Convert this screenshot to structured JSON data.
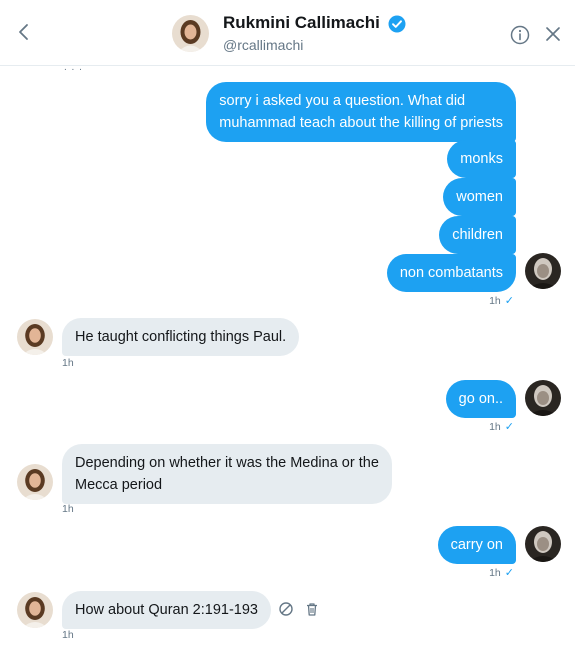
{
  "header": {
    "name": "Rukmini Callimachi",
    "handle": "@rcallimachi"
  },
  "colors": {
    "accent": "#1da1f2",
    "incoming_bubble": "#e6ecf0",
    "muted_text": "#657786"
  },
  "messages": {
    "m1": {
      "lines": [
        "sorry i asked you a question. What did",
        "muhammad teach about the killing of priests"
      ]
    },
    "m2": {
      "text": "monks"
    },
    "m3": {
      "text": "women"
    },
    "m4": {
      "text": "children"
    },
    "m5": {
      "text": "non combatants",
      "time": "1h"
    },
    "m6": {
      "text": "He taught conflicting things Paul.",
      "time": "1h"
    },
    "m7": {
      "text": "go on..",
      "time": "1h"
    },
    "m8": {
      "lines": [
        "Depending on whether it was the Medina or the",
        "Mecca period"
      ],
      "time": "1h"
    },
    "m9": {
      "text": "carry on",
      "time": "1h"
    },
    "m10": {
      "text": "How about Quran 2:191-193",
      "time": "1h"
    }
  },
  "icons": {
    "back": "chevron-left-icon",
    "verified": "verified-badge-icon",
    "info": "info-icon",
    "close": "close-icon",
    "report": "block-icon",
    "delete": "trash-icon",
    "read": "checkmark-icon"
  }
}
